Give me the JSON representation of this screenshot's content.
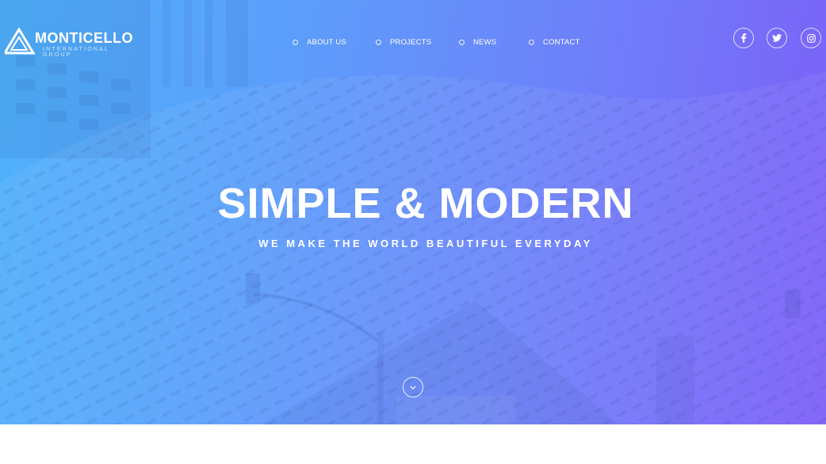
{
  "brand": {
    "name": "MONTICELLO",
    "tagline": "INTERNATIONAL GROUP"
  },
  "nav": {
    "items": [
      {
        "label": "ABOUT US"
      },
      {
        "label": "PROJECTS"
      },
      {
        "label": "NEWS"
      },
      {
        "label": "CONTACT"
      }
    ]
  },
  "social": [
    {
      "icon": "facebook-icon"
    },
    {
      "icon": "twitter-icon"
    },
    {
      "icon": "instagram-icon"
    }
  ],
  "hero": {
    "title": "SIMPLE & MODERN",
    "subtitle": "WE MAKE THE WORLD BEAUTIFUL EVERYDAY",
    "scroll_icon": "chevron-down-icon"
  },
  "colors": {
    "gradient_start": "#4fb2fb",
    "gradient_end": "#7d5ef8",
    "text": "#ffffff"
  }
}
